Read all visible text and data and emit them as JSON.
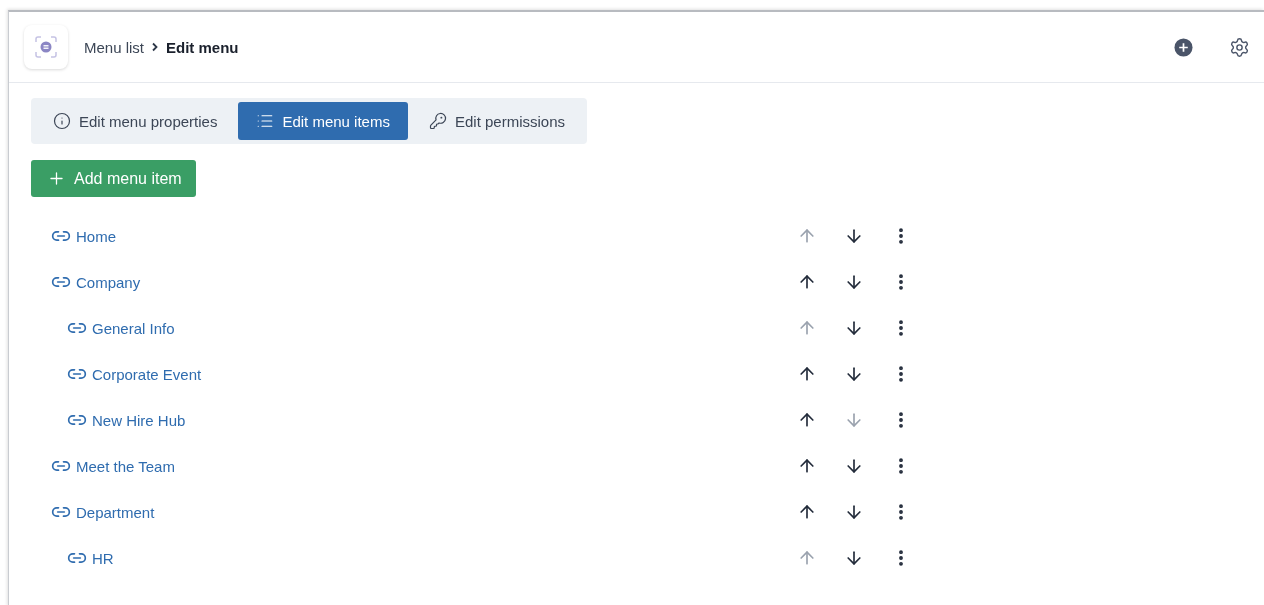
{
  "header": {
    "breadcrumb": [
      {
        "label": "Menu list",
        "current": false
      },
      {
        "label": "Edit menu",
        "current": true
      }
    ]
  },
  "tabs": [
    {
      "label": "Edit menu properties",
      "selected": false
    },
    {
      "label": "Edit menu items",
      "selected": true
    },
    {
      "label": "Edit permissions",
      "selected": false
    }
  ],
  "add_button": {
    "label": "Add menu item"
  },
  "menu_items": [
    {
      "label": "Home",
      "up_disabled": true,
      "down_disabled": false
    },
    {
      "label": "Company",
      "up_disabled": false,
      "down_disabled": false,
      "children": [
        {
          "label": "General Info",
          "up_disabled": true,
          "down_disabled": false
        },
        {
          "label": "Corporate Event",
          "up_disabled": false,
          "down_disabled": false
        },
        {
          "label": "New Hire Hub",
          "up_disabled": false,
          "down_disabled": true
        }
      ]
    },
    {
      "label": "Meet the Team",
      "up_disabled": false,
      "down_disabled": false
    },
    {
      "label": "Department",
      "up_disabled": false,
      "down_disabled": false,
      "children": [
        {
          "label": "HR",
          "up_disabled": true,
          "down_disabled": false
        }
      ]
    }
  ]
}
